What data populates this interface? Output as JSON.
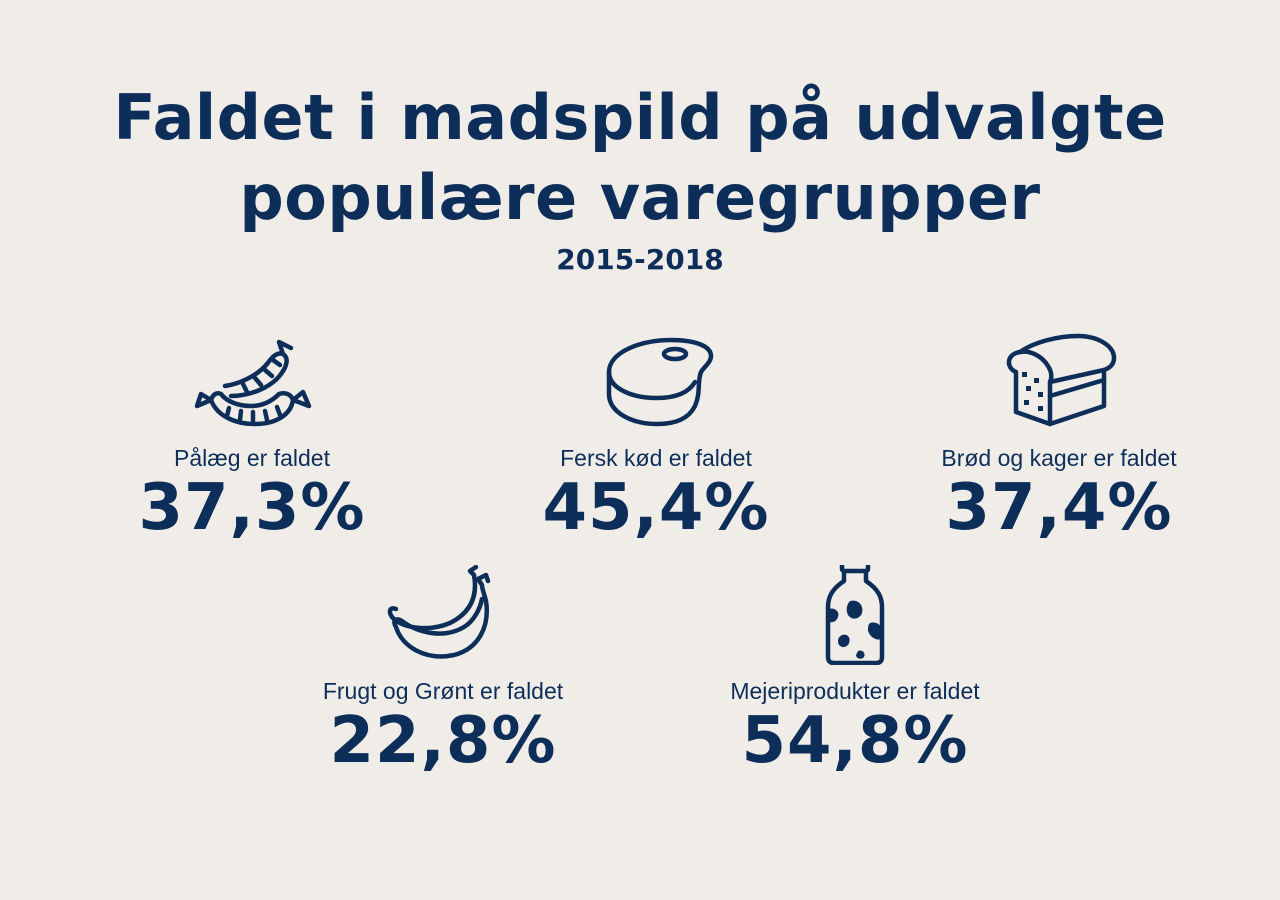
{
  "title_line1": "Faldet i madspild på udvalgte",
  "title_line2": "populære varegrupper",
  "subtitle": "2015-2018",
  "stats": [
    {
      "label": "Pålæg er faldet",
      "value": "37,3%",
      "icon": "sausage-icon"
    },
    {
      "label": "Fersk kød er faldet",
      "value": "45,4%",
      "icon": "steak-icon"
    },
    {
      "label": "Brød og kager er faldet",
      "value": "37,4%",
      "icon": "bread-icon"
    },
    {
      "label": "Frugt og Grønt er faldet",
      "value": "22,8%",
      "icon": "banana-icon"
    },
    {
      "label": "Mejeriprodukter er faldet",
      "value": "54,8%",
      "icon": "milk-bottle-icon"
    }
  ],
  "colors": {
    "background": "#f0ede9",
    "text": "#0e2e5a"
  }
}
